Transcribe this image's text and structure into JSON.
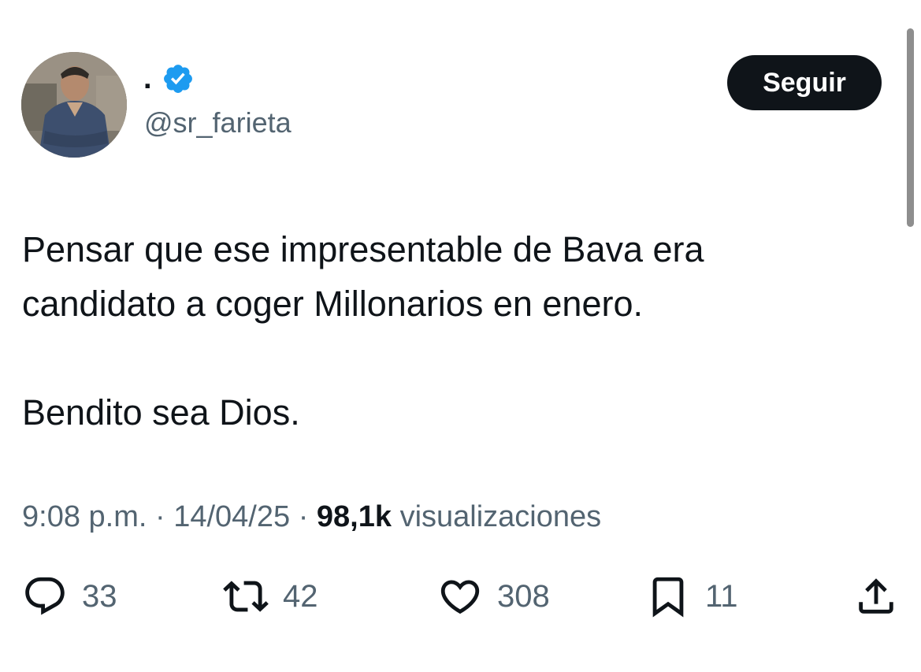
{
  "author": {
    "display_name": ".",
    "handle": "@sr_farieta",
    "verified_icon": "verified-badge-icon",
    "verified_color": "#1d9bf0"
  },
  "follow_button": {
    "label": "Seguir"
  },
  "tweet": {
    "line1": "Pensar que ese impresentable de Bava era",
    "line2": "candidato a coger Millonarios en enero.",
    "line3": "Bendito sea Dios."
  },
  "meta": {
    "time": "9:08 p.m.",
    "separator": "·",
    "date": "14/04/25",
    "views_count": "98,1k",
    "views_label": "visualizaciones"
  },
  "actions": {
    "replies": {
      "icon": "reply-icon",
      "count": "33"
    },
    "reposts": {
      "icon": "repost-icon",
      "count": "42"
    },
    "likes": {
      "icon": "heart-icon",
      "count": "308"
    },
    "bookmarks": {
      "icon": "bookmark-icon",
      "count": "11"
    },
    "share": {
      "icon": "share-icon"
    }
  },
  "colors": {
    "text_primary": "#0f1419",
    "text_secondary": "#536471",
    "button_bg": "#0f1419",
    "button_text": "#ffffff"
  }
}
